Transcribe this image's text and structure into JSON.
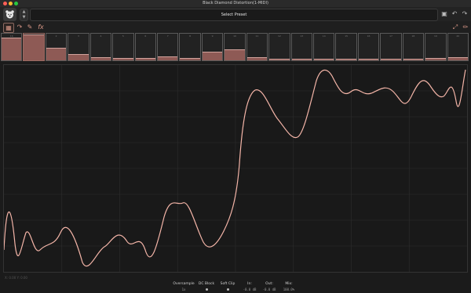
{
  "window": {
    "title": "Black Diamond Distortion(1-MIDI)",
    "traffic_colors": [
      "#ff5f57",
      "#febc2e",
      "#28c840"
    ]
  },
  "toolbar": {
    "preset_label": "Select Preset",
    "icons": [
      "logo-icon",
      "stepper-icon",
      "save-icon",
      "undo-icon",
      "redo-icon"
    ]
  },
  "modes": {
    "icons": [
      "steps-icon",
      "curve-icon",
      "pen-icon",
      "fx-icon",
      "expand-icon",
      "pencil-icon"
    ]
  },
  "strip": {
    "slot_numbers": [
      "16",
      "1",
      "2",
      "3",
      "4",
      "5",
      "6",
      "7",
      "8",
      "9",
      "10",
      "11",
      "12",
      "13",
      "14",
      "15",
      "16",
      "17",
      "18",
      "19",
      "20"
    ],
    "levels": [
      0.82,
      0.95,
      0.45,
      0.22,
      0.1,
      0.05,
      0.05,
      0.12,
      0.05,
      0.28,
      0.38,
      0.08,
      0.02,
      0.02,
      0.02,
      0.02,
      0.02,
      0.02,
      0.02,
      0.06,
      0.1
    ],
    "accent": "#8e5a55",
    "cap_color": "#d1a39c"
  },
  "graph": {
    "coord_readout": "X: 0.00 Y: 0.00",
    "curve_color": "#f4b5a8"
  },
  "footer": {
    "oversample": {
      "label": "Oversample",
      "value": "1x"
    },
    "dc_block": {
      "label": "DC Block",
      "value": "on"
    },
    "soft_clip": {
      "label": "Soft Clip",
      "value": "on"
    },
    "input": {
      "label": "In:",
      "value": "-0.0 dB"
    },
    "output": {
      "label": "Out:",
      "value": "-0.0 dB"
    },
    "mix": {
      "label": "Mix:",
      "value": "100.0%"
    }
  }
}
